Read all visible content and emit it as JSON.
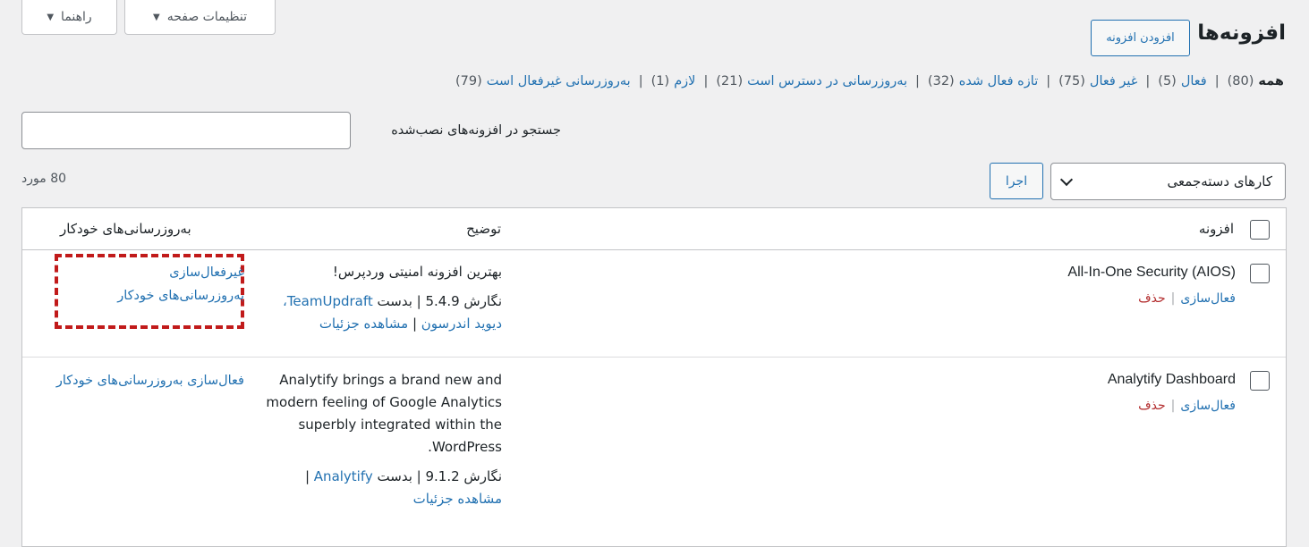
{
  "screen_tabs": {
    "help_label": "راهنما",
    "options_label": "تنظیمات صفحه"
  },
  "header": {
    "title": "افزونه‌ها",
    "add_new_label": "افزودن افزونه"
  },
  "filters": [
    {
      "label": "همه",
      "count": "(80)",
      "current": true
    },
    {
      "label": "فعال",
      "count": "(5)"
    },
    {
      "label": "غیر فعال",
      "count": "(75)"
    },
    {
      "label": "تازه فعال شده",
      "count": "(32)"
    },
    {
      "label": "به‌روزرسانی در دسترس است",
      "count": "(21)"
    },
    {
      "label": "لازم",
      "count": "(1)"
    },
    {
      "label": "به‌روزرسانی غیرفعال است",
      "count": "(79)"
    }
  ],
  "search": {
    "label": "جستجو در افزونه‌های نصب‌شده",
    "value": ""
  },
  "bulk": {
    "selected": "کارهای دسته‌جمعی",
    "apply_label": "اجرا"
  },
  "items_count": "80 مورد",
  "table": {
    "col_plugin": "افزونه",
    "col_description": "توضیح",
    "col_auto_updates": "به‌روزرسانی‌های خودکار",
    "rows": [
      {
        "name": "All-In-One Security (AIOS)",
        "action_primary": "فعال‌سازی",
        "action_delete": "حذف",
        "description": "بهترین افزونه امنیتی وردپرس!",
        "version_prefix": "نگارش 5.4.9 | بدست",
        "author": "TeamUpdraft، دیوید اندرسون",
        "sep": "|",
        "details": "مشاهده جزئیات",
        "auto_update_line1": "غیرفعال‌سازی",
        "auto_update_line2": "به‌روزرسانی‌های خودکار"
      },
      {
        "name": "Analytify Dashboard",
        "action_primary": "فعال‌سازی",
        "action_delete": "حذف",
        "description": "Analytify brings a brand new and modern feeling of Google Analytics superbly integrated within the WordPress.",
        "version_prefix": "نگارش 9.1.2 | بدست",
        "author": "Analytify",
        "sep": "|",
        "details": "مشاهده جزئیات",
        "auto_update_line1": "فعال‌سازی به‌روزرسانی‌های خودکار"
      }
    ]
  }
}
